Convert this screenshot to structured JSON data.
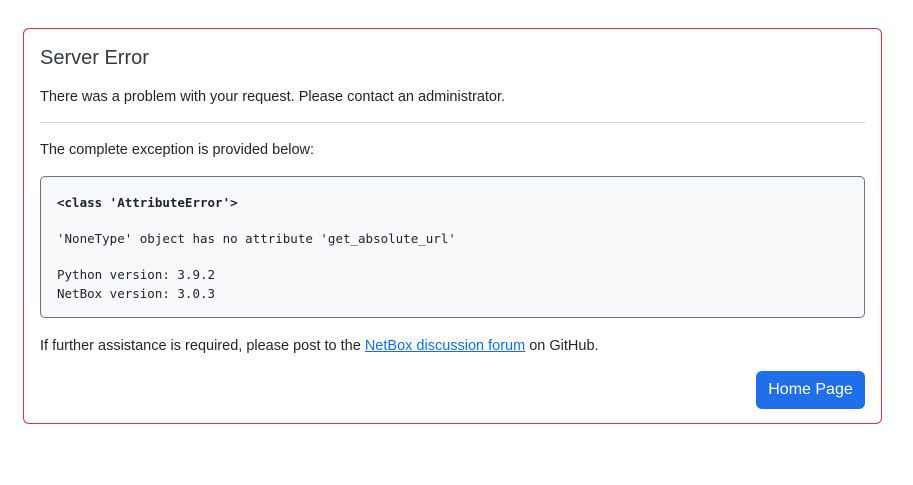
{
  "error": {
    "title": "Server Error",
    "message": "There was a problem with your request. Please contact an administrator.",
    "exception_intro": "The complete exception is provided below:",
    "exception": {
      "class_line": "<class 'AttributeError'>",
      "detail_line": "'NoneType' object has no attribute 'get_absolute_url'",
      "python_version_line": "Python version: 3.9.2",
      "netbox_version_line": "NetBox version: 3.0.3"
    },
    "assistance": {
      "prefix": "If further assistance is required, please post to the ",
      "link_text": "NetBox discussion forum",
      "suffix": " on GitHub."
    },
    "home_button_label": "Home Page"
  },
  "colors": {
    "card_border": "#dc3545",
    "link": "#0d6efd",
    "button_bg": "#1f6fea"
  }
}
